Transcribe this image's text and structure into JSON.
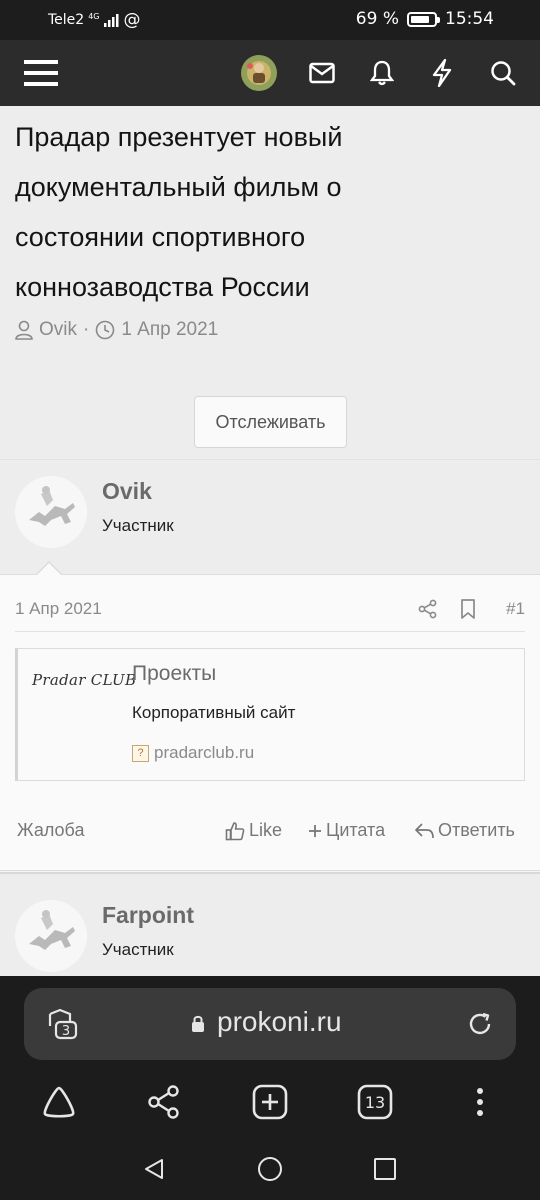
{
  "status_bar": {
    "carrier": "Tele2",
    "network": "4G",
    "battery_text": "69 %",
    "battery_level": 0.69,
    "time": "15:54"
  },
  "app_header": {
    "icons": [
      "menu-icon",
      "avatar",
      "mail-icon",
      "bell-icon",
      "bolt-icon",
      "search-icon"
    ]
  },
  "thread": {
    "title": "Прадар презентует новый документальный фильм о состоянии спортивного коннозаводства России",
    "author": "Ovik",
    "separator": "·",
    "date": "1 Апр 2021",
    "follow_label": "Отслеживать"
  },
  "posts": [
    {
      "username": "Ovik",
      "role": "Участник",
      "date": "1 Апр 2021",
      "number": "#1",
      "embed": {
        "logo": "Pradar CLUB",
        "title": "Проекты",
        "description": "Корпоративный сайт",
        "url": "pradarclub.ru"
      },
      "actions": {
        "report": "Жалоба",
        "like": "Like",
        "quote": "Цитата",
        "reply": "Ответить"
      }
    },
    {
      "username": "Farpoint",
      "role": "Участник"
    }
  ],
  "browser": {
    "url": "prokoni.ru",
    "tab_group_count": "3",
    "tabs_count": "13"
  }
}
